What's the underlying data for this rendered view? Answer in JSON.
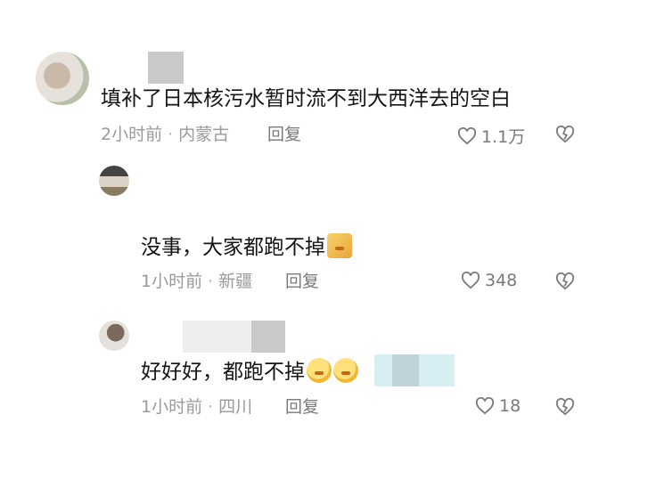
{
  "comments": [
    {
      "text": "填补了日本核污水暂时流不到大西洋去的空白",
      "time": "2小时前",
      "location": "内蒙古",
      "reply_label": "回复",
      "likes": "1.1万"
    },
    {
      "text": "没事，大家都跑不掉",
      "time": "1小时前",
      "location": "新疆",
      "reply_label": "回复",
      "likes": "348"
    },
    {
      "text": "好好好，都跑不掉",
      "time": "1小时前",
      "location": "四川",
      "reply_label": "回复",
      "likes": "18"
    }
  ],
  "icons": {
    "like": "heart-outline-icon",
    "dislike": "broken-heart-icon",
    "emoji": "face-emoji-icon"
  },
  "colors": {
    "text": "#141414",
    "meta": "#9a9a9a",
    "icon": "#7a7a7a"
  }
}
